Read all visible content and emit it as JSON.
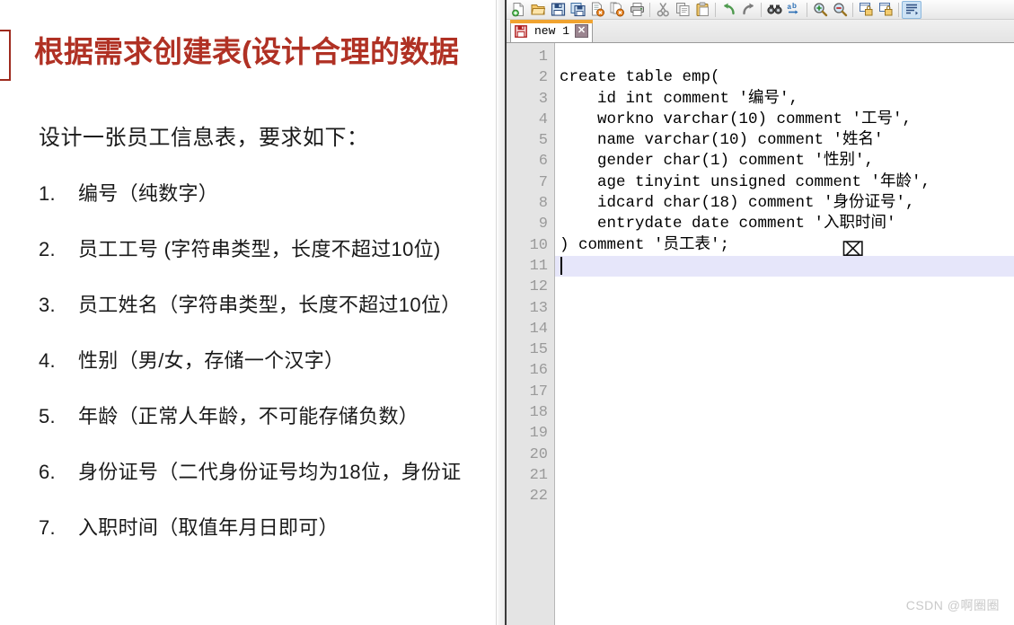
{
  "slide": {
    "title": "根据需求创建表(设计合理的数据",
    "subtitle": "设计一张员工信息表，要求如下：",
    "items": [
      {
        "num": "1.",
        "text": "编号（纯数字）"
      },
      {
        "num": "2.",
        "text": "员工工号 (字符串类型，长度不超过10位)"
      },
      {
        "num": "3.",
        "text": "员工姓名（字符串类型，长度不超过10位）"
      },
      {
        "num": "4.",
        "text": "性别（男/女，存储一个汉字）"
      },
      {
        "num": "5.",
        "text": "年龄（正常人年龄，不可能存储负数）"
      },
      {
        "num": "6.",
        "text": "身份证号（二代身份证号均为18位，身份证"
      },
      {
        "num": "7.",
        "text": "入职时间（取值年月日即可）"
      }
    ],
    "title_color": "#b03124",
    "text_color": "#1a1a1a"
  },
  "editor": {
    "toolbar": {
      "buttons": [
        {
          "name": "new-file-icon",
          "title": "New"
        },
        {
          "name": "open-file-icon",
          "title": "Open"
        },
        {
          "name": "save-icon",
          "title": "Save"
        },
        {
          "name": "save-all-icon",
          "title": "Save All"
        },
        {
          "name": "close-file-icon",
          "title": "Close"
        },
        {
          "name": "close-all-files-icon",
          "title": "Close All"
        },
        {
          "name": "print-icon",
          "title": "Print"
        },
        {
          "name": "cut-icon",
          "title": "Cut"
        },
        {
          "name": "copy-icon",
          "title": "Copy"
        },
        {
          "name": "paste-icon",
          "title": "Paste"
        },
        {
          "name": "undo-icon",
          "title": "Undo"
        },
        {
          "name": "redo-icon",
          "title": "Redo"
        },
        {
          "name": "find-icon",
          "title": "Find"
        },
        {
          "name": "replace-icon",
          "title": "Replace"
        },
        {
          "name": "zoom-in-icon",
          "title": "Zoom In"
        },
        {
          "name": "zoom-out-icon",
          "title": "Zoom Out"
        },
        {
          "name": "sync-vertical-scroll-icon",
          "title": "Synchronize Vertical Scrolling"
        },
        {
          "name": "sync-horizontal-scroll-icon",
          "title": "Synchronize Horizontal Scrolling"
        },
        {
          "name": "word-wrap-icon",
          "title": "Word wrap"
        }
      ]
    },
    "tab": {
      "label": "new 1",
      "close_glyph": "✕",
      "accent_color": "#f0a330"
    },
    "gutter": {
      "lines": [
        "1",
        "2",
        "3",
        "4",
        "5",
        "6",
        "7",
        "8",
        "9",
        "10",
        "11",
        "12",
        "13",
        "14",
        "15",
        "16",
        "17",
        "18",
        "19",
        "20",
        "21",
        "22"
      ]
    },
    "code": {
      "current_line": 11,
      "lines": [
        "",
        "create table emp(",
        "    id int comment '编号',",
        "    workno varchar(10) comment '工号',",
        "    name varchar(10) comment '姓名'",
        "    gender char(1) comment '性别',",
        "    age tinyint unsigned comment '年龄',",
        "    idcard char(18) comment '身份证号',",
        "    entrydate date comment '入职时间'",
        ") comment '员工表';",
        "",
        "",
        "",
        "",
        "",
        "",
        "",
        "",
        "",
        "",
        "",
        ""
      ]
    }
  },
  "watermark": "CSDN @啊圈圈"
}
